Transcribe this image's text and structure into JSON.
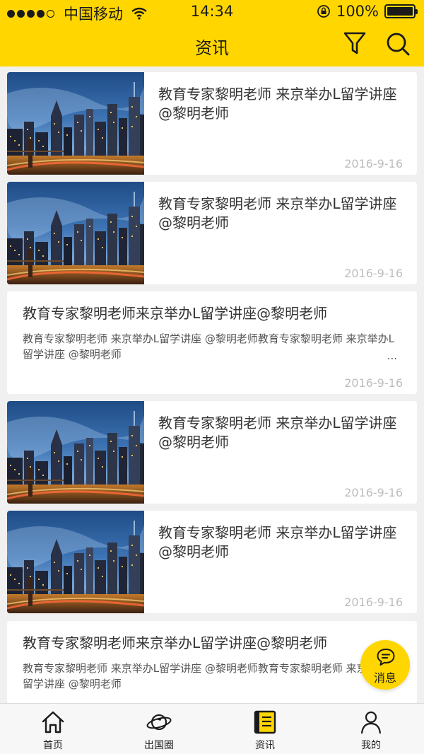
{
  "status_bar": {
    "carrier": "中国移动",
    "time": "14:34",
    "battery": "100%"
  },
  "nav": {
    "title": "资讯",
    "filter_icon": "filter-icon",
    "search_icon": "search-icon"
  },
  "articles": [
    {
      "type": "image",
      "title": "教育专家黎明老师   来京举办L留学讲座  @黎明老师",
      "date": "2016-9-16"
    },
    {
      "type": "image",
      "title": "教育专家黎明老师   来京举办L留学讲座  @黎明老师",
      "date": "2016-9-16"
    },
    {
      "type": "text",
      "title": "教育专家黎明老师来京举办L留学讲座@黎明老师",
      "summary": "教育专家黎明老师   来京举办L留学讲座   @黎明老师教育专家黎明老师   来京举办L留学讲座   @黎明老师",
      "ellipsis": "...",
      "date": "2016-9-16"
    },
    {
      "type": "image",
      "title": "教育专家黎明老师   来京举办L留学讲座  @黎明老师",
      "date": "2016-9-16"
    },
    {
      "type": "image",
      "title": "教育专家黎明老师   来京举办L留学讲座  @黎明老师",
      "date": "2016-9-16"
    },
    {
      "type": "text",
      "title": "教育专家黎明老师来京举办L留学讲座@黎明老师",
      "summary": "教育专家黎明老师   来京举办L留学讲座   @黎明老师教育专家黎明老师   来京举办L留学讲座   @黎明老师"
    }
  ],
  "fab": {
    "label": "消息",
    "icon": "message-bubble-icon"
  },
  "tabs": [
    {
      "label": "首页",
      "icon": "home-icon"
    },
    {
      "label": "出国圈",
      "icon": "planet-plane-icon"
    },
    {
      "label": "资讯",
      "icon": "news-icon",
      "active": true
    },
    {
      "label": "我的",
      "icon": "person-icon"
    }
  ],
  "colors": {
    "accent": "#ffd600",
    "background": "#f0f0f0",
    "date": "#bdbdbd"
  }
}
